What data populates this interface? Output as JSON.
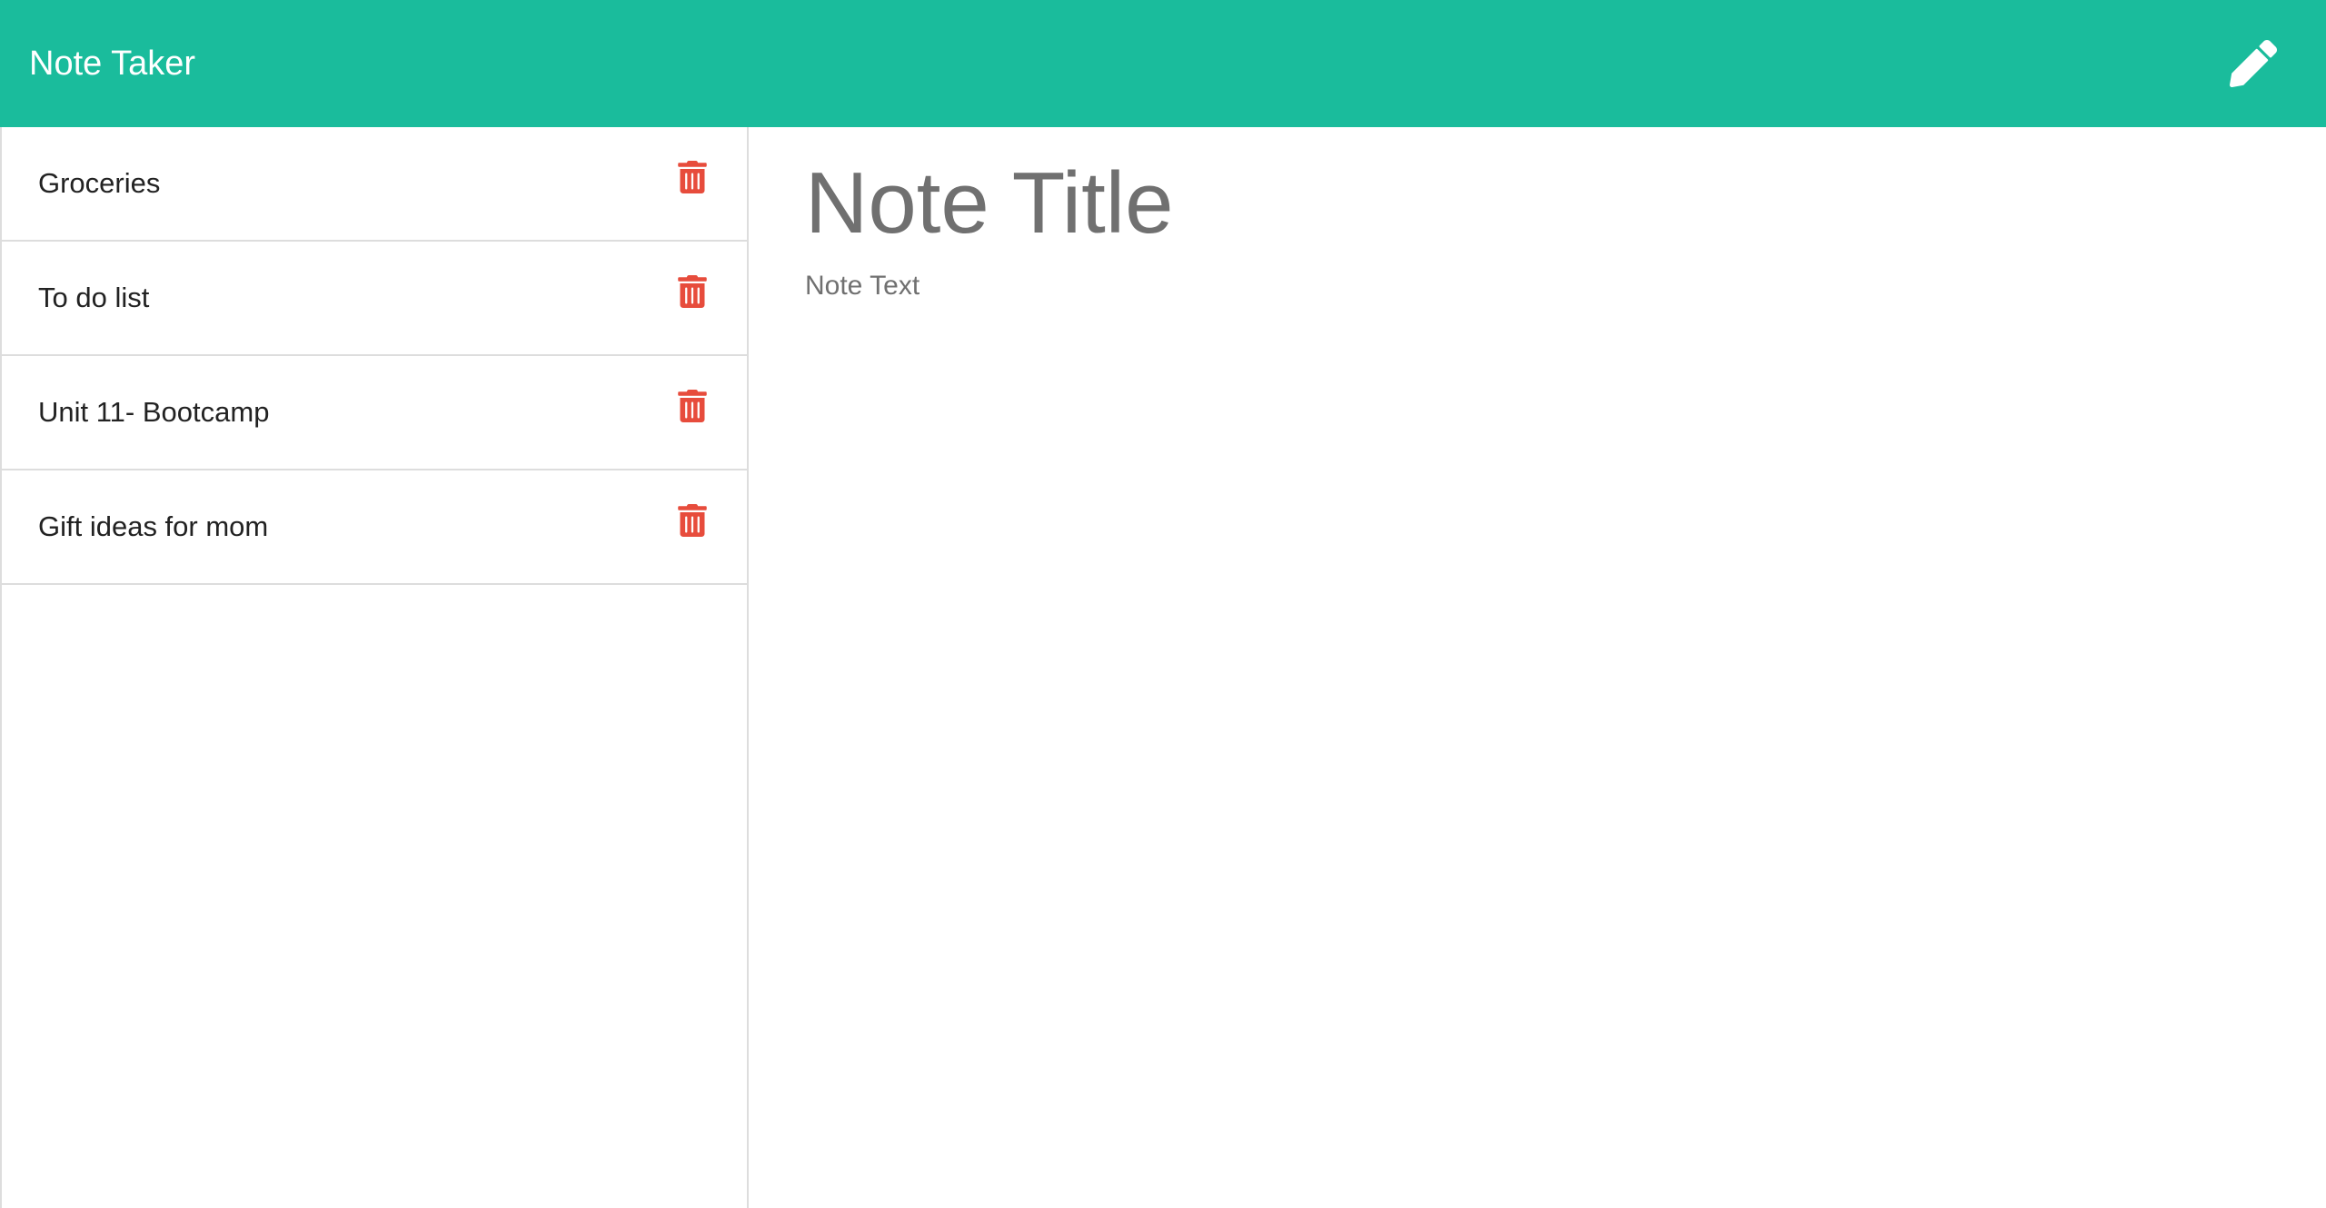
{
  "app": {
    "title": "Note Taker",
    "accent_color": "#1abc9c",
    "new_note_icon": "pencil-icon"
  },
  "notes": [
    {
      "title": "Groceries",
      "delete_icon": "trash-icon"
    },
    {
      "title": "To do list",
      "delete_icon": "trash-icon"
    },
    {
      "title": "Unit 11- Bootcamp",
      "delete_icon": "trash-icon"
    },
    {
      "title": "Gift ideas for mom",
      "delete_icon": "trash-icon"
    }
  ],
  "editor": {
    "title_placeholder": "Note Title",
    "text_placeholder": "Note Text",
    "title_value": "",
    "text_value": ""
  },
  "colors": {
    "delete": "#e74c3c",
    "placeholder": "#707070"
  }
}
